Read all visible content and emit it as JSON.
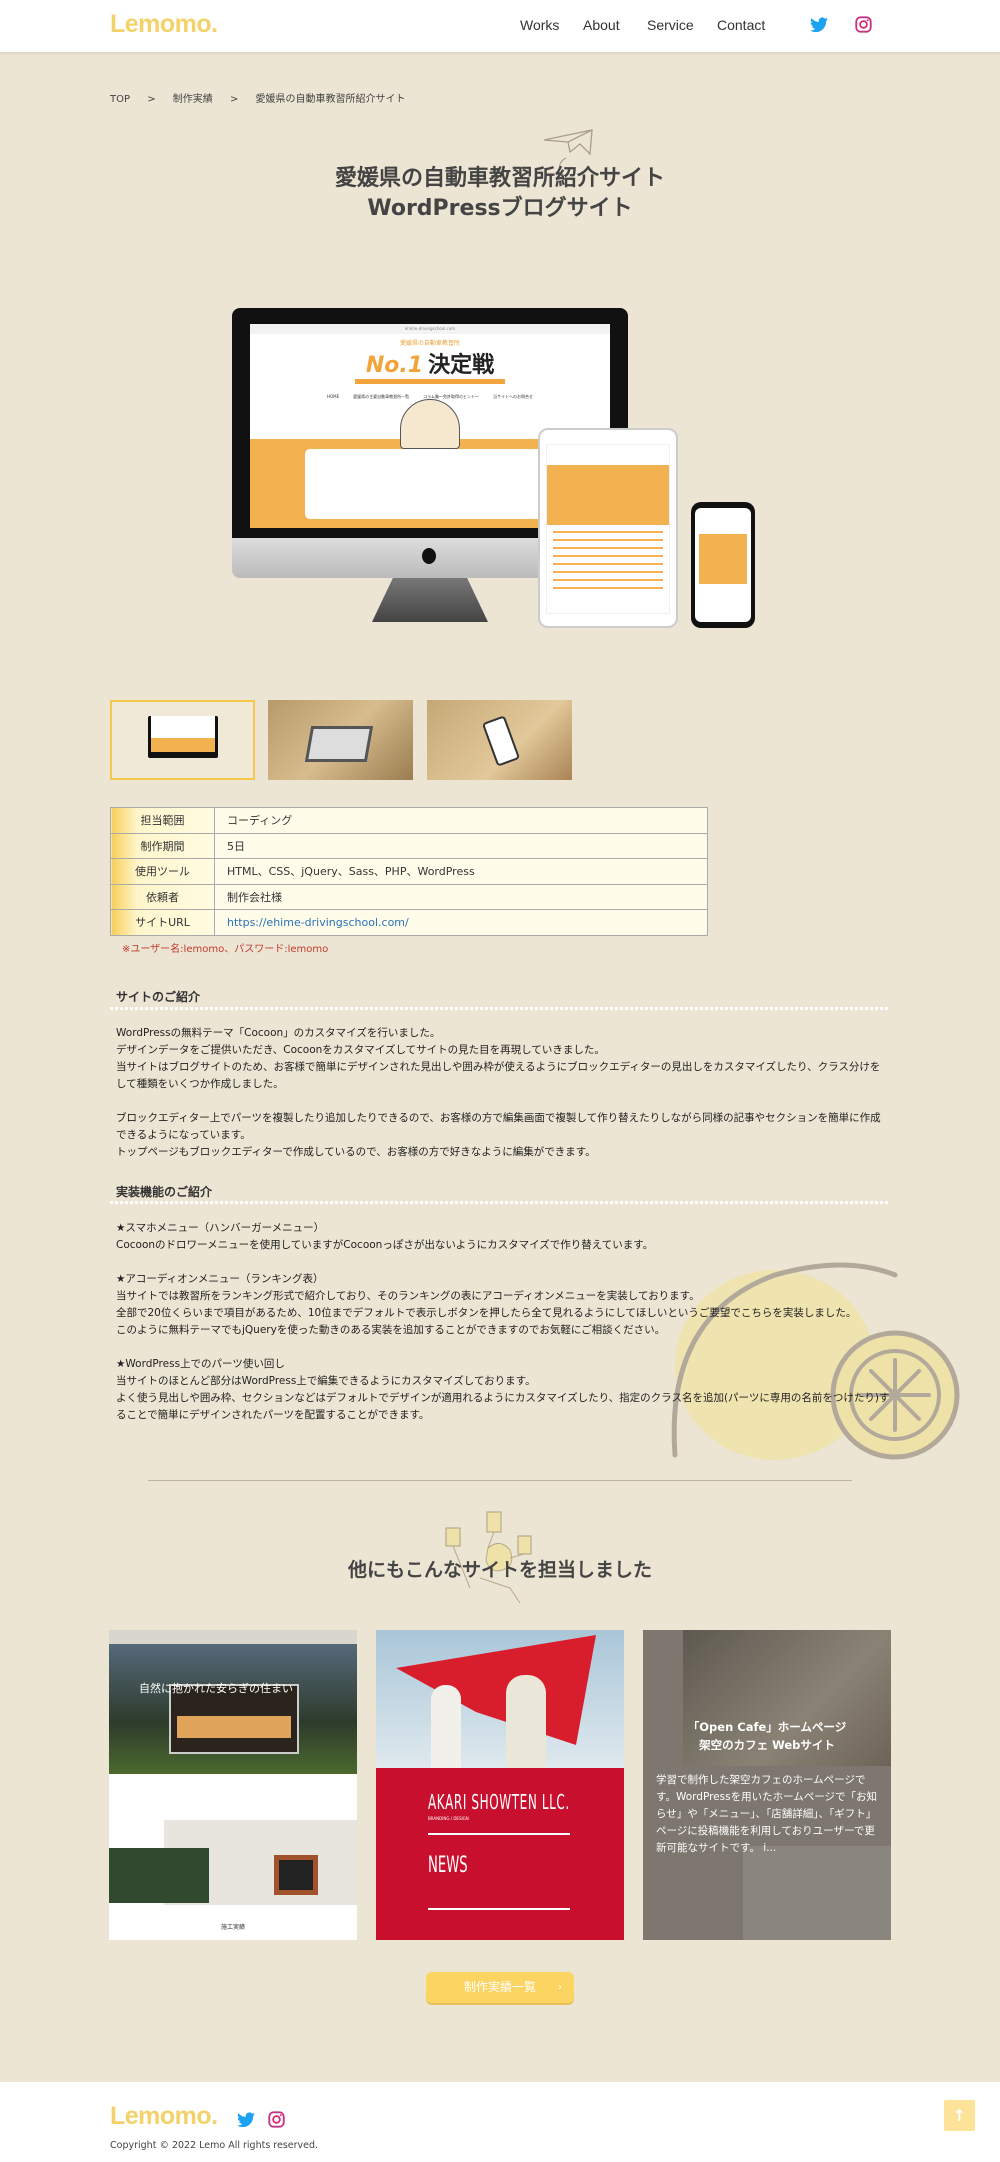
{
  "header": {
    "logo": "Lemomo.",
    "nav": [
      "Works",
      "About",
      "Service",
      "Contact"
    ],
    "social": [
      "twitter-icon",
      "instagram-icon"
    ]
  },
  "breadcrumb": [
    "TOP",
    ">",
    "制作実績",
    ">",
    "愛媛県の自動車教習所紹介サイト"
  ],
  "title": {
    "line1": "愛媛県の自動車教習所紹介サイト",
    "line2": "WordPressブログサイト"
  },
  "mockup": {
    "url": "ehime-drivingschool.com",
    "headline": "No.1",
    "headline_jp": "決定戦",
    "sub": "愛媛県の自動車教習所",
    "menu": [
      "HOME",
      "愛媛県の主要自動車教習所一覧",
      "コラム集〜免許取得のヒント〜",
      "当サイトへのお問合せ"
    ]
  },
  "details": [
    {
      "label": "担当範囲",
      "value": "コーディング"
    },
    {
      "label": "制作期間",
      "value": "5日"
    },
    {
      "label": "使用ツール",
      "value": "HTML、CSS、jQuery、Sass、PHP、WordPress"
    },
    {
      "label": "依頼者",
      "value": "制作会社様"
    },
    {
      "label": "サイトURL",
      "value": "https://ehime-drivingschool.com/"
    }
  ],
  "note": "※ユーザー名:lemomo、パスワード:lemomo",
  "intro": {
    "heading": "サイトのご紹介",
    "lines": [
      "WordPressの無料テーマ「Cocoon」のカスタマイズを行いました。",
      "デザインデータをご提供いただき、Cocoonをカスタマイズしてサイトの見た目を再現していきました。",
      "当サイトはブログサイトのため、お客様で簡単にデザインされた見出しや囲み枠が使えるようにブロックエディターの見出しをカスタマイズしたり、クラス分けを",
      "して種類をいくつか作成しました。",
      "",
      "ブロックエディター上でパーツを複製したり追加したりできるので、お客様の方で編集画面で複製して作り替えたりしながら同様の記事やセクションを簡単に作成",
      "できるようになっています。",
      "トップページもブロックエディターで作成しているので、お客様の方で好きなように編集ができます。"
    ]
  },
  "features": {
    "heading": "実装機能のご紹介",
    "lines": [
      "★スマホメニュー（ハンバーガーメニュー）",
      "Cocoonのドロワーメニューを使用していますがCocoonっぽさが出ないようにカスタマイズで作り替えています。",
      "",
      "★アコーディオンメニュー（ランキング表）",
      "当サイトでは教習所をランキング形式で紹介しており、そのランキングの表にアコーディオンメニューを実装しております。",
      "全部で20位くらいまで項目があるため、10位までデフォルトで表示しボタンを押したら全て見れるようにしてほしいというご要望でこちらを実装しました。",
      "このように無料テーマでもjQueryを使った動きのある実装を追加することができますのでお気軽にご相談ください。",
      "",
      "★WordPress上でのパーツ使い回し",
      "当サイトのほとんど部分はWordPress上で編集できるようにカスタマイズしております。",
      "よく使う見出しや囲み枠、セクションなどはデフォルトでデザインが適用れるようにカスタマイズしたり、指定のクラス名を追加(パーツに専用の名前をつけたり)す",
      "ることで簡単にデザインされたパーツを配置することができます。"
    ]
  },
  "others": {
    "heading": "他にもこんなサイトを担当しました",
    "cards": [
      {
        "hero": "自然に抱かれた安らぎの住まい",
        "section": "施工実績"
      },
      {
        "brand": "AKARI SHOWTEN LLC.",
        "sub": "BRANDING / DESIGN",
        "news": "NEWS"
      },
      {
        "title1": "「Open Cafe」ホームページ",
        "title2": "架空のカフェ Webサイト",
        "desc": "学習で制作した架空カフェのホームページです。WordPressを用いたホームページで「お知らせ」や「メニュー」、「店舗詳細」、「ギフト」ページに投稿機能を利用しておりユーザーで更新可能なサイトです。 i..."
      }
    ]
  },
  "button": {
    "label": "制作実績一覧",
    "icon": "chevron-right-icon"
  },
  "footer": {
    "logo": "Lemomo.",
    "copyright": "Copyright © 2022 Lemo All rights reserved.",
    "top_icon": "arrow-up-icon"
  },
  "colors": {
    "brand": "#f4d26a",
    "background": "#ede5d3",
    "button": "#fcd462",
    "note": "#c0392b",
    "link": "#2a73b8",
    "twitter": "#1da1f2",
    "instagram": "#c13584"
  }
}
